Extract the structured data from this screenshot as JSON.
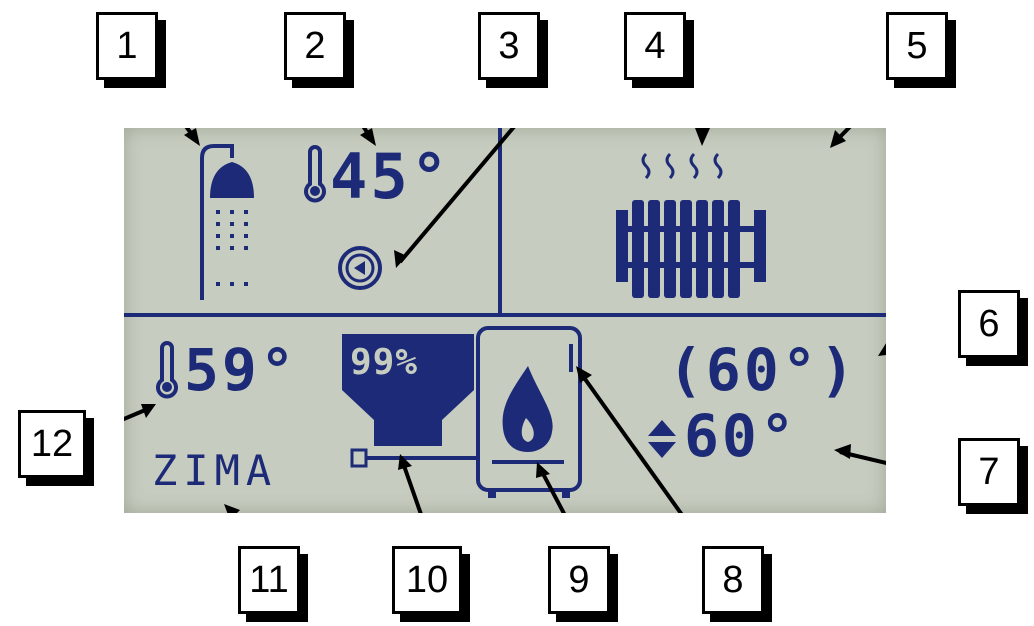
{
  "display": {
    "dhw_temperature": "45°",
    "boiler_temperature": "59°",
    "fuel_level": "99%",
    "preset_temperature": "(60°)",
    "set_temperature": "60°",
    "season_mode": "ZIMA"
  },
  "callouts": [
    "1",
    "2",
    "3",
    "4",
    "5",
    "6",
    "7",
    "8",
    "9",
    "10",
    "11",
    "12"
  ],
  "colors": {
    "lcd_background": "#c6ccbf",
    "lcd_pixels": "#1c2a78",
    "callout_border": "#000000"
  },
  "icons": [
    "shower-icon",
    "thermometer-icon",
    "pump-icon",
    "heat-waves-icon",
    "radiator-icon",
    "fuel-hopper-icon",
    "boiler-flame-icon",
    "up-down-arrows-icon"
  ]
}
